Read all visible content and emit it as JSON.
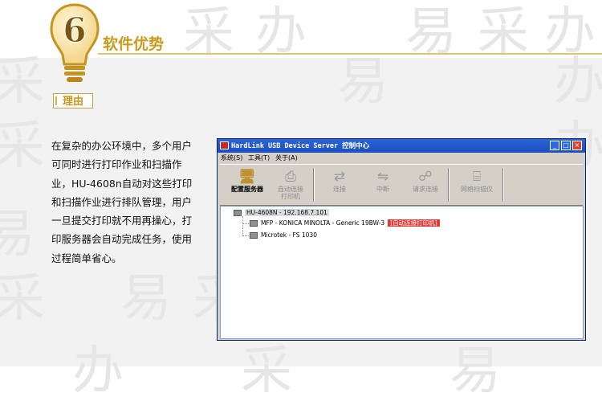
{
  "badge_number": "6",
  "section_title": "软件优势",
  "tag": "理由",
  "description": "在复杂的办公环境中，多个用户可同时进行打印作业和扫描作业，HU-4608n自动对这些打印和扫描作业进行排队管理，用户一旦提交打印就不用再操心，打印服务器会自动完成任务，使用过程简单省心。",
  "watermark": [
    "采",
    "办",
    "易",
    "采",
    "办",
    "易"
  ],
  "window": {
    "title": "HardLink USB Device Server 控制中心",
    "buttons": {
      "minimize": "_",
      "maximize": "□",
      "close": "×"
    },
    "menu": [
      "系统(S)",
      "工具(T)",
      "关于(A)"
    ],
    "toolbar": [
      {
        "label": "配置服务器",
        "icon": "server-config-icon",
        "enabled": true
      },
      {
        "label": "自动连接\n打印机",
        "icon": "auto-printer-icon",
        "enabled": false
      },
      {
        "label": "连接",
        "icon": "connect-icon",
        "enabled": false
      },
      {
        "label": "中断",
        "icon": "disconnect-icon",
        "enabled": false
      },
      {
        "label": "请求连接",
        "icon": "request-connect-icon",
        "enabled": false
      },
      {
        "label": "网络扫描仪",
        "icon": "network-scanner-icon",
        "enabled": false
      }
    ],
    "tree": {
      "root": "HU-4608N - 192.168.7.101",
      "children": [
        {
          "label": "MFP - KONICA MINOLTA - Generic 19BW-3",
          "badge": "[自动连接打印机]"
        },
        {
          "label": "Microtek - FS 1030",
          "badge": ""
        }
      ]
    }
  },
  "colors": {
    "accent": "#c99b1c",
    "band": "#f2f2f2",
    "badge": "#e53935",
    "titlebar": "#2a63d9"
  }
}
